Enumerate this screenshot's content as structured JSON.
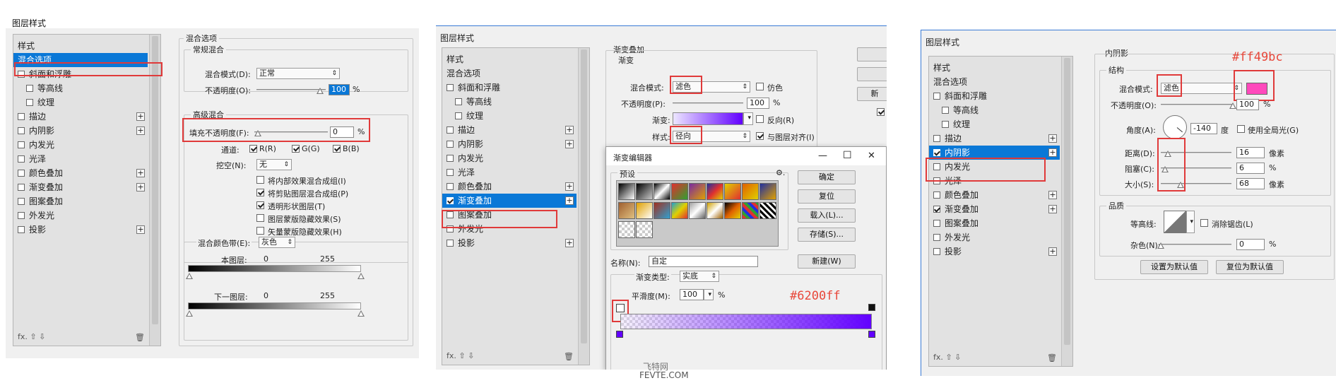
{
  "panel1": {
    "title": "图层样式",
    "styles": [
      {
        "label": "样式",
        "checkbox": false,
        "plus": false,
        "selected": false
      },
      {
        "label": "混合选项",
        "checkbox": false,
        "plus": false,
        "selected": true
      },
      {
        "label": "斜面和浮雕",
        "checkbox": true,
        "checked": false,
        "plus": false
      },
      {
        "label": "等高线",
        "checkbox": true,
        "checked": false,
        "plus": false,
        "indent": true
      },
      {
        "label": "纹理",
        "checkbox": true,
        "checked": false,
        "plus": false,
        "indent": true
      },
      {
        "label": "描边",
        "checkbox": true,
        "checked": false,
        "plus": true
      },
      {
        "label": "内阴影",
        "checkbox": true,
        "checked": false,
        "plus": true
      },
      {
        "label": "内发光",
        "checkbox": true,
        "checked": false,
        "plus": false
      },
      {
        "label": "光泽",
        "checkbox": true,
        "checked": false,
        "plus": false
      },
      {
        "label": "颜色叠加",
        "checkbox": true,
        "checked": false,
        "plus": true
      },
      {
        "label": "渐变叠加",
        "checkbox": true,
        "checked": false,
        "plus": true
      },
      {
        "label": "图案叠加",
        "checkbox": true,
        "checked": false,
        "plus": false
      },
      {
        "label": "外发光",
        "checkbox": true,
        "checked": false,
        "plus": false
      },
      {
        "label": "投影",
        "checkbox": true,
        "checked": false,
        "plus": true
      }
    ],
    "footer": "fx.  ⇧  ⇩",
    "section_title": "混合选项",
    "general_title": "常规混合",
    "blend_mode_label": "混合模式(D):",
    "blend_mode_value": "正常",
    "opacity_label": "不透明度(O):",
    "opacity_value": "100",
    "percent": "%",
    "advanced_title": "高级混合",
    "fill_opacity_label": "填充不透明度(F):",
    "fill_opacity_value": "0",
    "channels_label": "通道:",
    "channels": [
      "R(R)",
      "G(G)",
      "B(B)"
    ],
    "knockout_label": "挖空(N):",
    "knockout_value": "无",
    "options": [
      {
        "label": "将内部效果混合成组(I)",
        "checked": false
      },
      {
        "label": "将剪贴图层混合成组(P)",
        "checked": true
      },
      {
        "label": "透明形状图层(T)",
        "checked": true
      },
      {
        "label": "图层蒙版隐藏效果(S)",
        "checked": false
      },
      {
        "label": "矢量蒙版隐藏效果(H)",
        "checked": false
      }
    ],
    "blend_if_label": "混合颜色带(E):",
    "blend_if_value": "灰色",
    "this_layer_label": "本图层:",
    "under_layer_label": "下一图层:",
    "range_min": "0",
    "range_max": "255"
  },
  "panel2": {
    "title": "图层样式",
    "styles": [
      {
        "label": "样式",
        "checkbox": false,
        "plus": false
      },
      {
        "label": "混合选项",
        "checkbox": false,
        "plus": false
      },
      {
        "label": "斜面和浮雕",
        "checkbox": true,
        "checked": false,
        "plus": false
      },
      {
        "label": "等高线",
        "checkbox": true,
        "checked": false,
        "plus": false,
        "indent": true
      },
      {
        "label": "纹理",
        "checkbox": true,
        "checked": false,
        "plus": false,
        "indent": true
      },
      {
        "label": "描边",
        "checkbox": true,
        "checked": false,
        "plus": true
      },
      {
        "label": "内阴影",
        "checkbox": true,
        "checked": false,
        "plus": true
      },
      {
        "label": "内发光",
        "checkbox": true,
        "checked": false,
        "plus": false
      },
      {
        "label": "光泽",
        "checkbox": true,
        "checked": false,
        "plus": false
      },
      {
        "label": "颜色叠加",
        "checkbox": true,
        "checked": false,
        "plus": true
      },
      {
        "label": "渐变叠加",
        "checkbox": true,
        "checked": true,
        "plus": true,
        "selected": true
      },
      {
        "label": "图案叠加",
        "checkbox": true,
        "checked": false,
        "plus": false
      },
      {
        "label": "外发光",
        "checkbox": true,
        "checked": false,
        "plus": false
      },
      {
        "label": "投影",
        "checkbox": true,
        "checked": false,
        "plus": true
      }
    ],
    "section_title": "渐变叠加",
    "sub_title": "渐变",
    "blend_mode_label": "混合模式:",
    "blend_mode_value": "滤色",
    "dither_label": "仿色",
    "opacity_label": "不透明度(P):",
    "opacity_value": "100",
    "gradient_label": "渐变:",
    "reverse_label": "反向(R)",
    "style_label": "样式:",
    "style_value": "径向",
    "align_label": "与图层对齐(I)",
    "side_btn": "新",
    "editor": {
      "title": "渐变编辑器",
      "presets_label": "预设",
      "gear": "⚙.",
      "ok": "确定",
      "reset": "复位",
      "load": "载入(L)...",
      "save": "存储(S)...",
      "name_label": "名称(N):",
      "name_value": "自定",
      "new_btn": "新建(W)",
      "type_label": "渐变类型:",
      "type_value": "实底",
      "smooth_label": "平滑度(M):",
      "smooth_value": "100",
      "percent": "%",
      "minimize": "—",
      "maximize": "☐",
      "close": "✕"
    },
    "annotation": "#6200ff",
    "watermark_top": "飞特网",
    "watermark_bottom": "FEVTE.COM"
  },
  "panel3": {
    "title": "图层样式",
    "styles": [
      {
        "label": "样式",
        "checkbox": false,
        "plus": false
      },
      {
        "label": "混合选项",
        "checkbox": false,
        "plus": false
      },
      {
        "label": "斜面和浮雕",
        "checkbox": true,
        "checked": false,
        "plus": false
      },
      {
        "label": "等高线",
        "checkbox": true,
        "checked": false,
        "plus": false,
        "indent": true
      },
      {
        "label": "纹理",
        "checkbox": true,
        "checked": false,
        "plus": false,
        "indent": true
      },
      {
        "label": "描边",
        "checkbox": true,
        "checked": false,
        "plus": true
      },
      {
        "label": "内阴影",
        "checkbox": true,
        "checked": true,
        "plus": true,
        "selected": true
      },
      {
        "label": "内发光",
        "checkbox": true,
        "checked": false,
        "plus": false
      },
      {
        "label": "光泽",
        "checkbox": true,
        "checked": false,
        "plus": false
      },
      {
        "label": "颜色叠加",
        "checkbox": true,
        "checked": false,
        "plus": true
      },
      {
        "label": "渐变叠加",
        "checkbox": true,
        "checked": true,
        "plus": true
      },
      {
        "label": "图案叠加",
        "checkbox": true,
        "checked": false,
        "plus": false
      },
      {
        "label": "外发光",
        "checkbox": true,
        "checked": false,
        "plus": false
      },
      {
        "label": "投影",
        "checkbox": true,
        "checked": false,
        "plus": true
      }
    ],
    "section_title": "内阴影",
    "structure_title": "结构",
    "blend_mode_label": "混合模式:",
    "blend_mode_value": "滤色",
    "swatch_color": "#ff49bc",
    "opacity_label": "不透明度(O):",
    "opacity_value": "100",
    "angle_label": "角度(A):",
    "angle_value": "-140",
    "degree": "度",
    "global_light_label": "使用全局光(G)",
    "distance_label": "距离(D):",
    "distance_value": "16",
    "choke_label": "阻塞(C):",
    "choke_value": "6",
    "size_label": "大小(S):",
    "size_value": "68",
    "px": "像素",
    "percent": "%",
    "quality_title": "品质",
    "contour_label": "等高线:",
    "antialias_label": "消除锯齿(L)",
    "noise_label": "杂色(N):",
    "noise_value": "0",
    "default_btn": "设置为默认值",
    "reset_btn": "复位为默认值",
    "annotation": "#ff49bc"
  },
  "colors": {
    "accent_blue": "#0a78d7",
    "highlight_red": "#e03a3a",
    "gradient_purple": "#6200ff",
    "pink": "#ff49bc"
  }
}
